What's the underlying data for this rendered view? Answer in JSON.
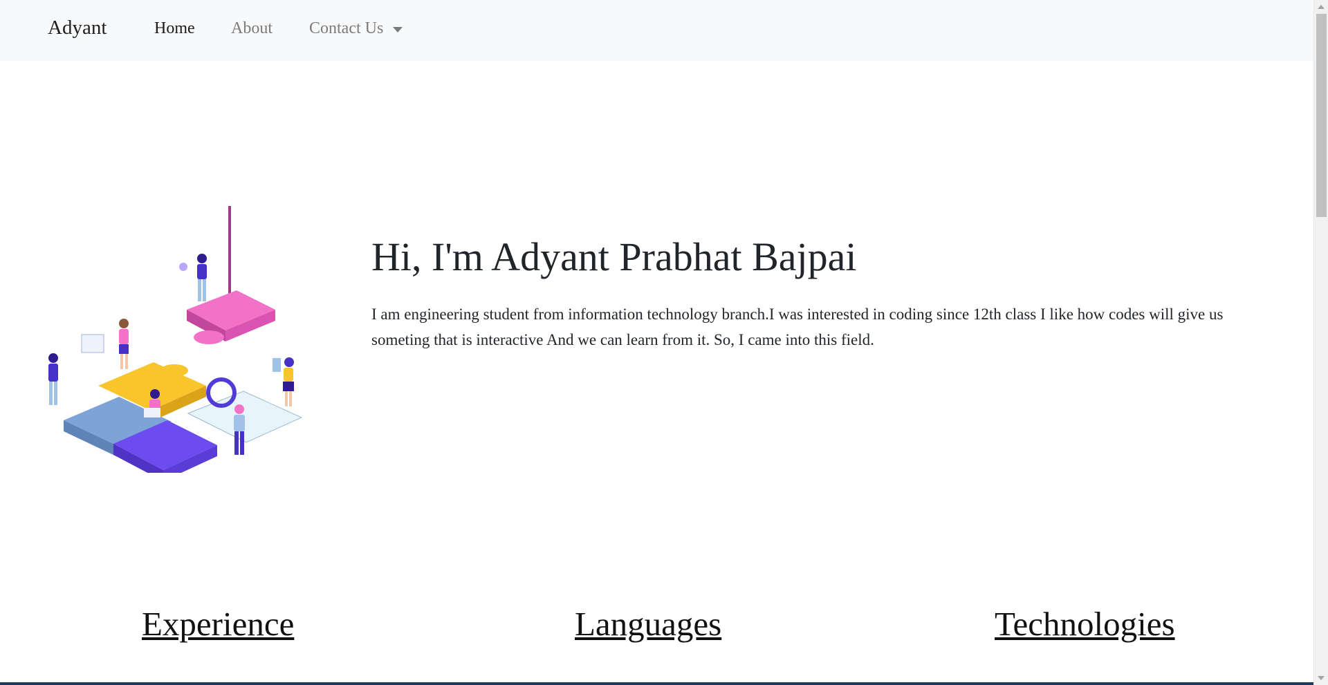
{
  "navbar": {
    "brand": "Adyant",
    "links": [
      {
        "label": "Home"
      },
      {
        "label": "About"
      },
      {
        "label": "Contact Us"
      }
    ]
  },
  "hero": {
    "title": "Hi, I'm Adyant Prabhat Bajpai",
    "description": "I am engineering student from information technology branch.I was interested in coding since 12th class I like how codes will give us someting that is interactive And we can learn from it. So, I came into this field."
  },
  "sections": [
    {
      "heading": "Experience"
    },
    {
      "heading": "Languages"
    },
    {
      "heading": "Technologies"
    }
  ],
  "colors": {
    "navbar_bg": "#f8f9fa",
    "puzzle_pink": "#f272c8",
    "puzzle_yellow": "#f9c52d",
    "puzzle_blue": "#7ea3d6",
    "puzzle_purple": "#6c4cf0",
    "puzzle_light": "#e8f4fb"
  },
  "icons": [
    "chevron-down-icon",
    "scroll-up-icon",
    "scroll-down-icon"
  ]
}
